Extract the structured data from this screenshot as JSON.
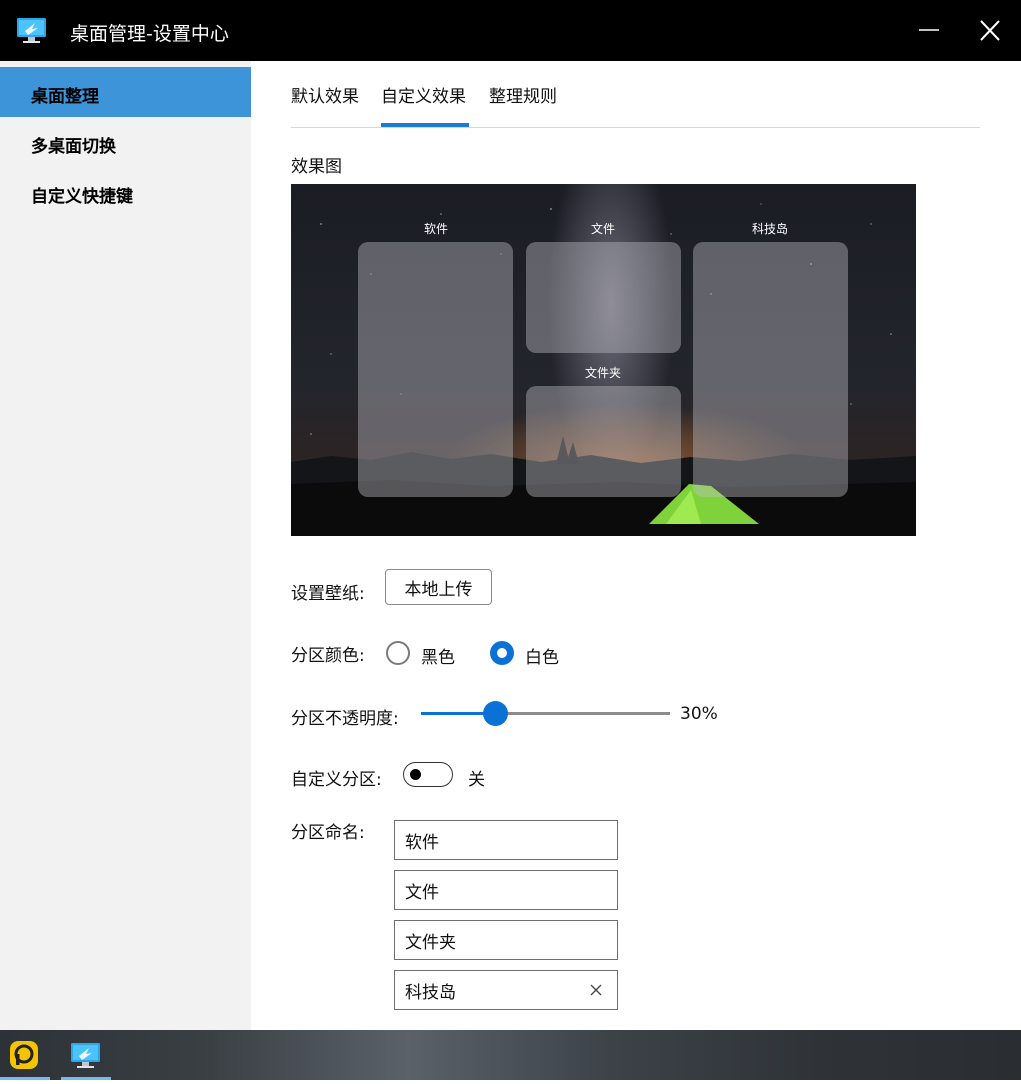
{
  "window": {
    "title": "桌面管理-设置中心",
    "icon": "monitor-icon",
    "controls": [
      "minimize-icon",
      "close-icon"
    ]
  },
  "sidebar": {
    "items": [
      {
        "label": "桌面整理",
        "active": true
      },
      {
        "label": "多桌面切换",
        "active": false
      },
      {
        "label": "自定义快捷键",
        "active": false
      }
    ],
    "accent_color": "#3d94d9"
  },
  "tabs": {
    "items": [
      {
        "label": "默认效果",
        "active": false
      },
      {
        "label": "自定义效果",
        "active": true
      },
      {
        "label": "整理规则",
        "active": false
      }
    ],
    "accent_color": "#1a7ad6"
  },
  "preview": {
    "label": "效果图",
    "zones": [
      "软件",
      "文件",
      "文件夹",
      "科技岛"
    ]
  },
  "wallpaper": {
    "label": "设置壁纸:",
    "button": "本地上传"
  },
  "partition_color": {
    "label": "分区颜色:",
    "options": [
      {
        "label": "黑色",
        "selected": false
      },
      {
        "label": "白色",
        "selected": true
      }
    ]
  },
  "opacity": {
    "label": "分区不透明度:",
    "value": 0.3,
    "display": "30%"
  },
  "custom_partition": {
    "label": "自定义分区:",
    "on": false,
    "state_label": "关"
  },
  "partition_names": {
    "label": "分区命名:",
    "values": [
      "软件",
      "文件",
      "文件夹",
      "科技岛"
    ]
  },
  "taskbar": {
    "apps": [
      "assistant-app-icon",
      "desktop-manager-icon"
    ]
  }
}
